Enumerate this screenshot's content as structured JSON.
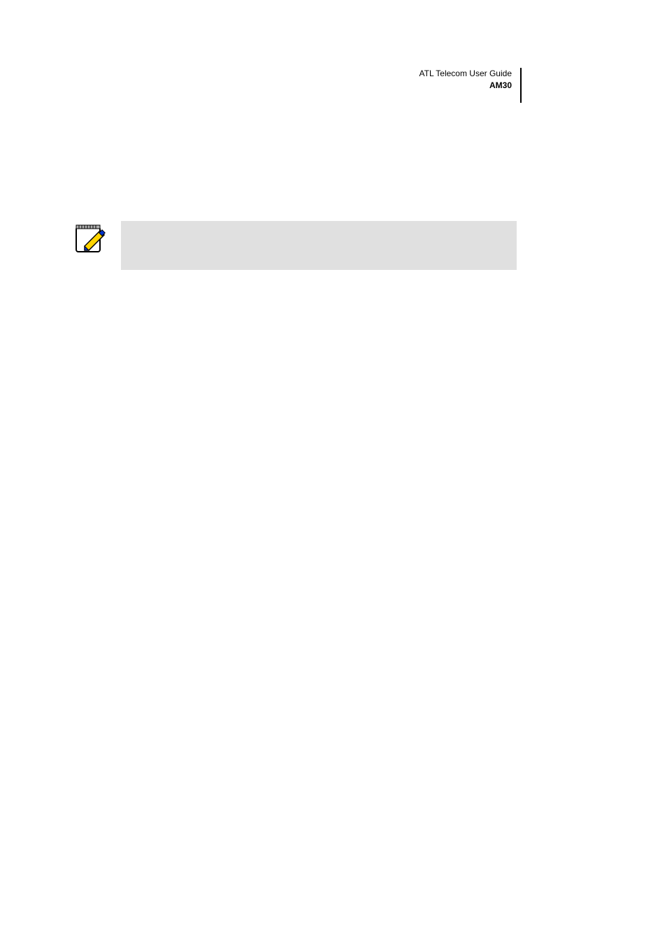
{
  "header": {
    "line1": "ATL Telecom User Guide",
    "line2": "AM30"
  }
}
